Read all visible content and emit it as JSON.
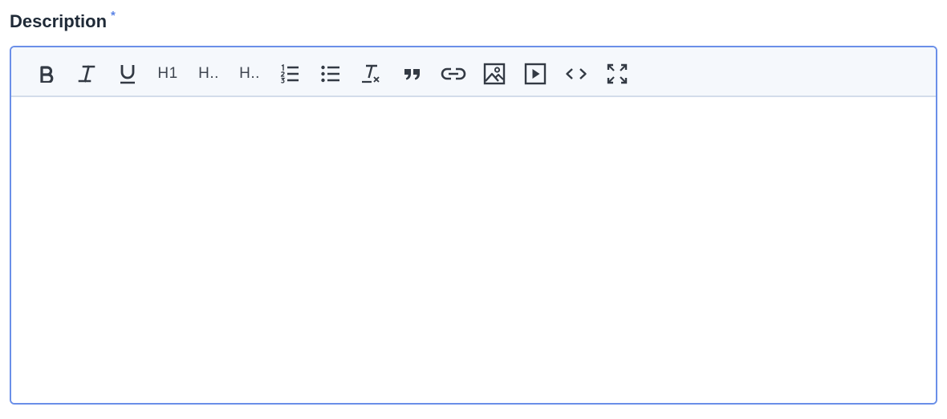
{
  "field": {
    "label": "Description",
    "required_mark": "*"
  },
  "toolbar": {
    "heading1_label": "H1",
    "heading2_label": "H..",
    "heading3_label": "H.."
  },
  "editor": {
    "content": ""
  },
  "colors": {
    "border_focus": "#6a8fe8",
    "required": "#5b84e6",
    "toolbar_bg": "#f5f8fc",
    "icon": "#333a44"
  }
}
